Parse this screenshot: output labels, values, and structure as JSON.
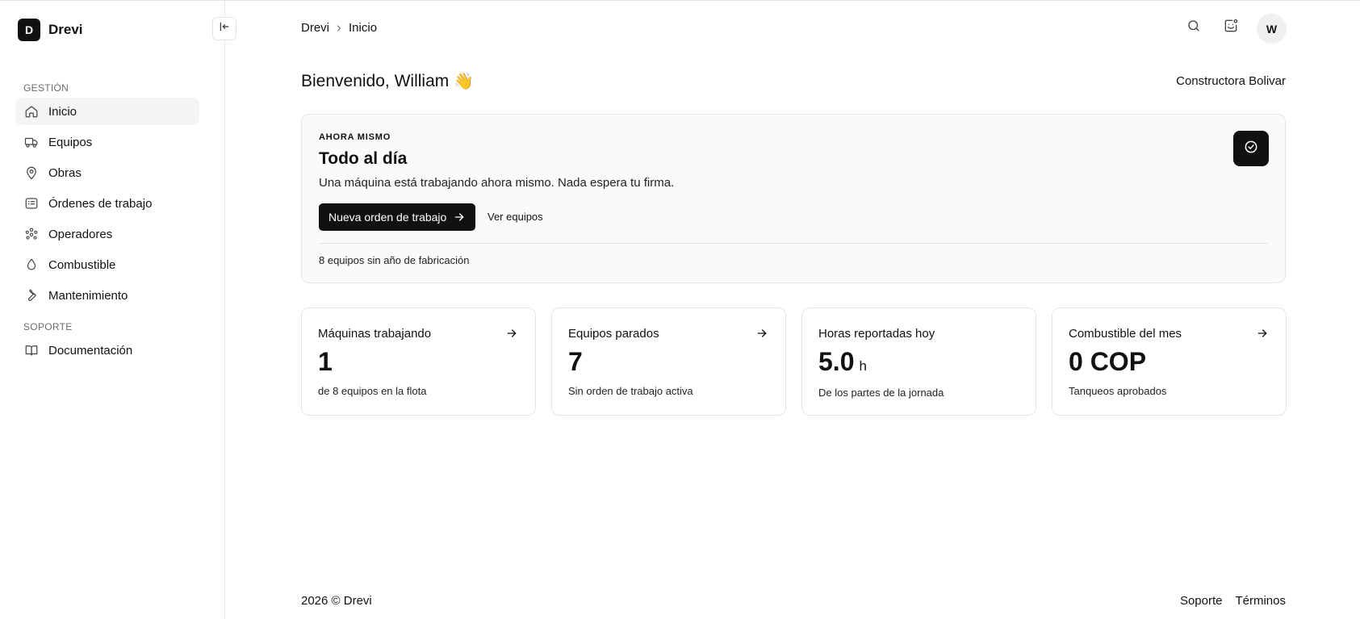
{
  "app": {
    "logo_letter": "D",
    "name": "Drevi"
  },
  "sidebar": {
    "groups": [
      {
        "label": "GESTIÓN",
        "items": [
          {
            "label": "Inicio",
            "icon": "home-icon",
            "active": true
          },
          {
            "label": "Equipos",
            "icon": "truck-icon"
          },
          {
            "label": "Obras",
            "icon": "map-pin-icon"
          },
          {
            "label": "Órdenes de trabajo",
            "icon": "clipboard-list-icon"
          },
          {
            "label": "Operadores",
            "icon": "users-icon"
          },
          {
            "label": "Combustible",
            "icon": "droplet-icon"
          },
          {
            "label": "Mantenimiento",
            "icon": "wrench-icon"
          }
        ]
      },
      {
        "label": "SOPORTE",
        "items": [
          {
            "label": "Documentación",
            "icon": "book-icon"
          }
        ]
      }
    ]
  },
  "header": {
    "breadcrumb": [
      "Drevi",
      "Inicio"
    ],
    "avatar_initial": "W"
  },
  "welcome": {
    "greeting": "Bienvenido, William",
    "emoji": "👋",
    "company": "Constructora Bolivar"
  },
  "hero": {
    "kicker": "AHORA MISMO",
    "title": "Todo al día",
    "description": "Una máquina está trabajando ahora mismo. Nada espera tu firma.",
    "primary_button": "Nueva orden de trabajo",
    "secondary_link": "Ver equipos",
    "note": "8 equipos sin año de fabricación"
  },
  "stats": [
    {
      "title": "Máquinas trabajando",
      "value": "1",
      "unit": "",
      "sub": "de 8 equipos en la flota",
      "has_arrow": true
    },
    {
      "title": "Equipos parados",
      "value": "7",
      "unit": "",
      "sub": "Sin orden de trabajo activa",
      "has_arrow": true
    },
    {
      "title": "Horas reportadas hoy",
      "value": "5.0",
      "unit": "h",
      "sub": "De los partes de la jornada",
      "has_arrow": false
    },
    {
      "title": "Combustible del mes",
      "value": "0 COP",
      "unit": "",
      "sub": "Tanqueos aprobados",
      "has_arrow": true
    }
  ],
  "footer": {
    "copyright": "2026 ©  Drevi",
    "links": [
      "Soporte",
      "Términos"
    ]
  },
  "colors": {
    "primary": "#111111",
    "border": "#e6e6e6",
    "active_bg": "#f4f4f4",
    "muted_text": "#6b6b6b"
  }
}
